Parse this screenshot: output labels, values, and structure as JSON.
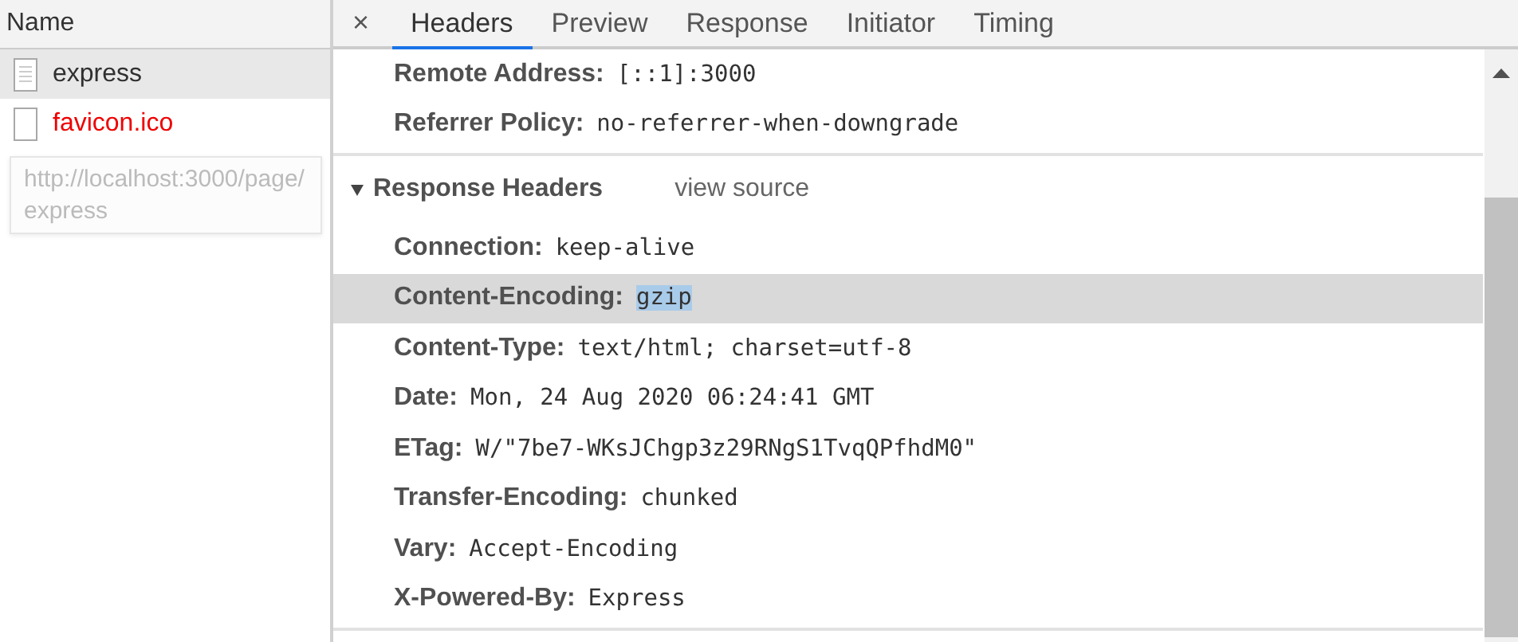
{
  "request_list": {
    "column": "Name",
    "items": [
      {
        "name": "express",
        "kind": "document",
        "selected": true,
        "failed": false
      },
      {
        "name": "favicon.ico",
        "kind": "blank",
        "selected": false,
        "failed": true
      }
    ],
    "tooltip": "http://localhost:3000/page/express"
  },
  "details": {
    "close": "×",
    "tabs": [
      {
        "label": "Headers",
        "selected": true
      },
      {
        "label": "Preview",
        "selected": false
      },
      {
        "label": "Response",
        "selected": false
      },
      {
        "label": "Initiator",
        "selected": false
      },
      {
        "label": "Timing",
        "selected": false
      }
    ],
    "general": [
      {
        "name": "Remote Address:",
        "value": "[::1]:3000"
      },
      {
        "name": "Referrer Policy:",
        "value": "no-referrer-when-downgrade"
      }
    ],
    "response_headers": {
      "title": "Response Headers",
      "expanded": true,
      "link": "view source",
      "rows": [
        {
          "name": "Connection:",
          "value": "keep-alive",
          "highlighted": false,
          "value_selected": false
        },
        {
          "name": "Content-Encoding:",
          "value": "gzip",
          "highlighted": true,
          "value_selected": true
        },
        {
          "name": "Content-Type:",
          "value": "text/html; charset=utf-8",
          "highlighted": false,
          "value_selected": false
        },
        {
          "name": "Date:",
          "value": "Mon, 24 Aug 2020 06:24:41 GMT",
          "highlighted": false,
          "value_selected": false
        },
        {
          "name": "ETag:",
          "value": "W/\"7be7-WKsJChgp3z29RNgS1TvqQPfhdM0\"",
          "highlighted": false,
          "value_selected": false
        },
        {
          "name": "Transfer-Encoding:",
          "value": "chunked",
          "highlighted": false,
          "value_selected": false
        },
        {
          "name": "Vary:",
          "value": "Accept-Encoding",
          "highlighted": false,
          "value_selected": false
        },
        {
          "name": "X-Powered-By:",
          "value": "Express",
          "highlighted": false,
          "value_selected": false
        }
      ]
    }
  }
}
